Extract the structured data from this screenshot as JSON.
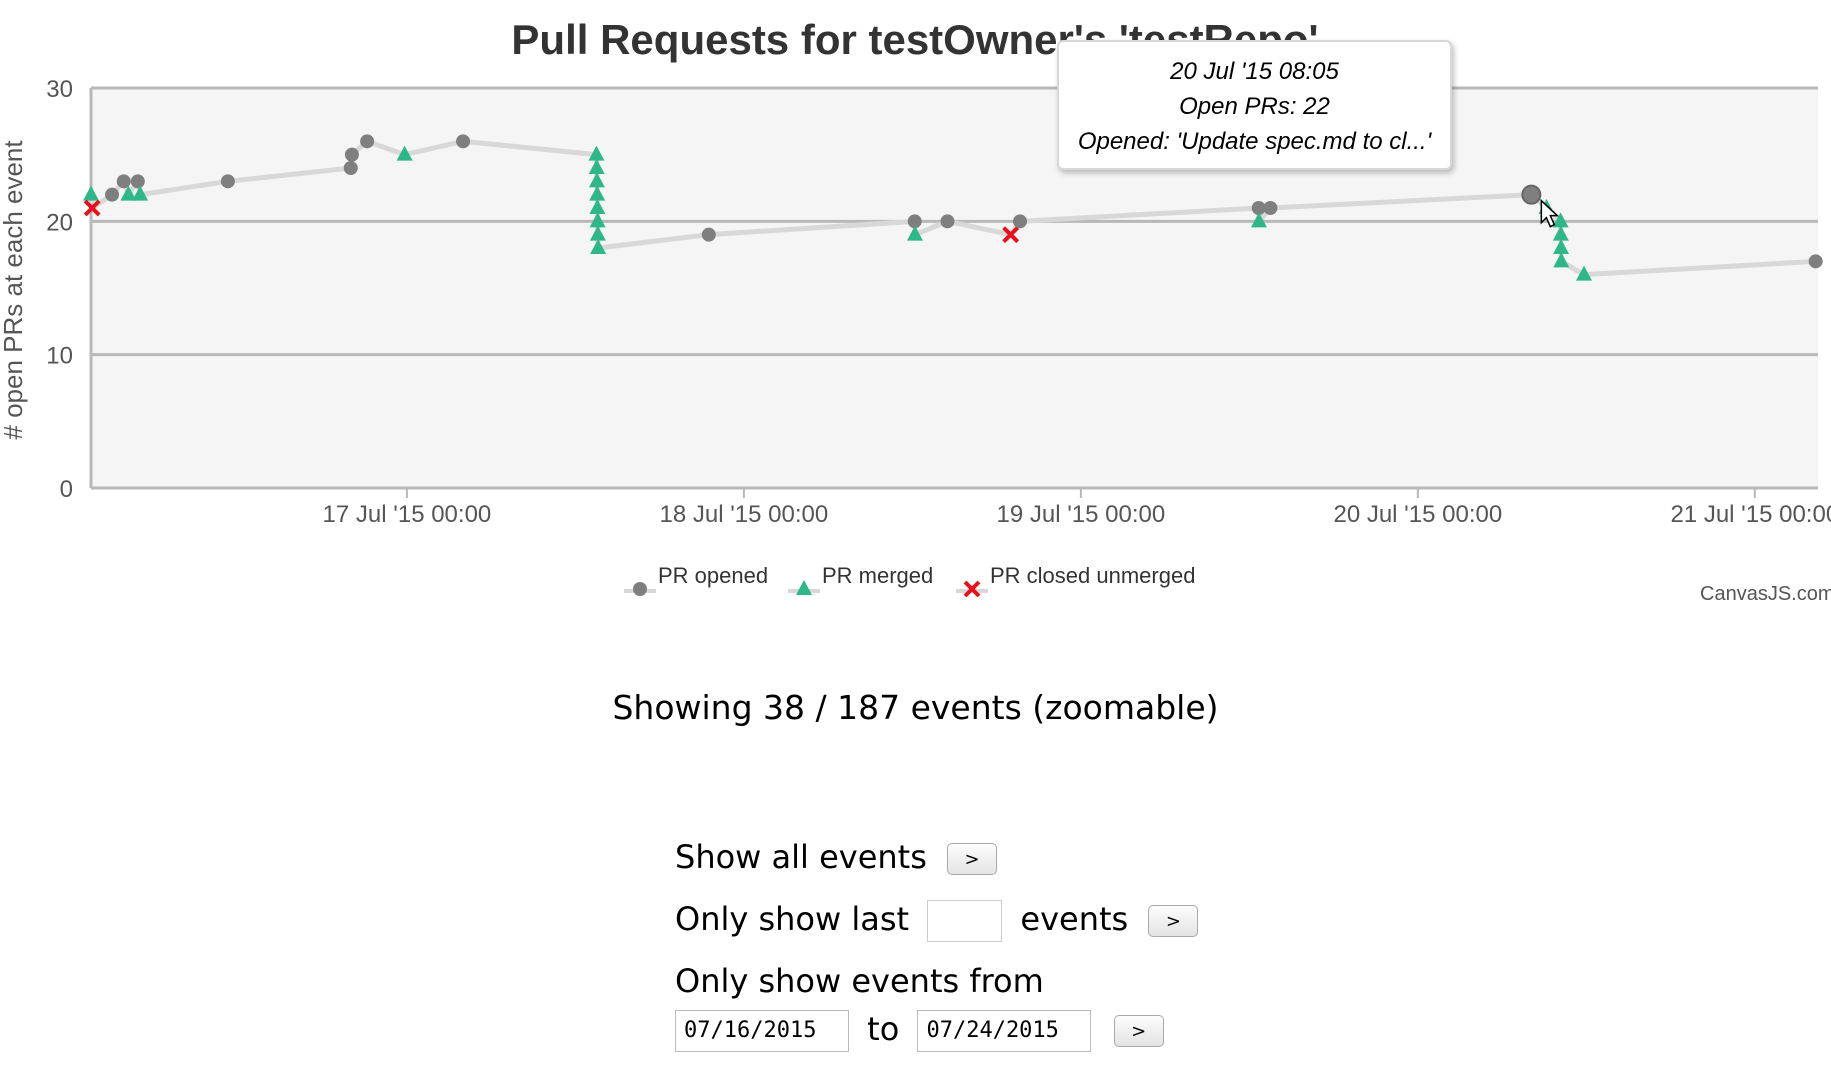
{
  "chart_data": {
    "type": "line",
    "title": "Pull Requests for testOwner's 'testRepo'",
    "xlabel": "",
    "ylabel": "# open PRs at each event",
    "ylim": [
      0,
      30
    ],
    "yticks": [
      0,
      10,
      20,
      30
    ],
    "xlim": [
      "16 Jul '15 01:30",
      "21 Jul '15 04:30"
    ],
    "xticks": [
      "17 Jul '15 00:00",
      "18 Jul '15 00:00",
      "19 Jul '15 00:00",
      "20 Jul '15 00:00",
      "21 Jul '15 00:00"
    ],
    "legend_position": "bottom",
    "grid": true,
    "colors": {
      "opened": "#7f7f7f",
      "merged": "#2eb88a",
      "closed": "#e8101a",
      "line": "#d8d8d8",
      "plot_bg": "#f5f5f5"
    },
    "series": [
      {
        "name": "PR opened",
        "marker": "circle"
      },
      {
        "name": "PR merged",
        "marker": "triangle"
      },
      {
        "name": "PR closed unmerged",
        "marker": "cross"
      }
    ],
    "points": [
      {
        "t": "16 Jul '15 01:30",
        "y": 22,
        "kind": "merged"
      },
      {
        "t": "16 Jul '15 01:35",
        "y": 21,
        "kind": "closed"
      },
      {
        "t": "16 Jul '15 03:00",
        "y": 22,
        "kind": "opened"
      },
      {
        "t": "16 Jul '15 03:50",
        "y": 23,
        "kind": "opened"
      },
      {
        "t": "16 Jul '15 04:10",
        "y": 22,
        "kind": "merged"
      },
      {
        "t": "16 Jul '15 04:50",
        "y": 23,
        "kind": "opened"
      },
      {
        "t": "16 Jul '15 05:00",
        "y": 22,
        "kind": "merged"
      },
      {
        "t": "16 Jul '15 11:15",
        "y": 23,
        "kind": "opened"
      },
      {
        "t": "16 Jul '15 20:00",
        "y": 24,
        "kind": "opened"
      },
      {
        "t": "16 Jul '15 20:05",
        "y": 25,
        "kind": "opened"
      },
      {
        "t": "16 Jul '15 21:10",
        "y": 26,
        "kind": "opened"
      },
      {
        "t": "16 Jul '15 23:50",
        "y": 25,
        "kind": "merged"
      },
      {
        "t": "17 Jul '15 04:00",
        "y": 26,
        "kind": "opened"
      },
      {
        "t": "17 Jul '15 13:30",
        "y": 25,
        "kind": "merged"
      },
      {
        "t": "17 Jul '15 13:31",
        "y": 24,
        "kind": "merged"
      },
      {
        "t": "17 Jul '15 13:32",
        "y": 23,
        "kind": "merged"
      },
      {
        "t": "17 Jul '15 13:33",
        "y": 22,
        "kind": "merged"
      },
      {
        "t": "17 Jul '15 13:34",
        "y": 21,
        "kind": "merged"
      },
      {
        "t": "17 Jul '15 13:35",
        "y": 20,
        "kind": "merged"
      },
      {
        "t": "17 Jul '15 13:36",
        "y": 19,
        "kind": "merged"
      },
      {
        "t": "17 Jul '15 13:37",
        "y": 18,
        "kind": "merged"
      },
      {
        "t": "17 Jul '15 21:30",
        "y": 19,
        "kind": "opened"
      },
      {
        "t": "18 Jul '15 12:10",
        "y": 20,
        "kind": "opened"
      },
      {
        "t": "18 Jul '15 12:11",
        "y": 19,
        "kind": "merged"
      },
      {
        "t": "18 Jul '15 14:30",
        "y": 20,
        "kind": "opened"
      },
      {
        "t": "18 Jul '15 19:00",
        "y": 19,
        "kind": "closed"
      },
      {
        "t": "18 Jul '15 19:40",
        "y": 20,
        "kind": "opened"
      },
      {
        "t": "19 Jul '15 12:40",
        "y": 21,
        "kind": "opened"
      },
      {
        "t": "19 Jul '15 12:41",
        "y": 20,
        "kind": "merged"
      },
      {
        "t": "19 Jul '15 13:30",
        "y": 21,
        "kind": "opened"
      },
      {
        "t": "20 Jul '15 08:05",
        "y": 22,
        "kind": "opened"
      },
      {
        "t": "20 Jul '15 09:10",
        "y": 21,
        "kind": "merged"
      },
      {
        "t": "20 Jul '15 10:10",
        "y": 20,
        "kind": "merged"
      },
      {
        "t": "20 Jul '15 10:11",
        "y": 19,
        "kind": "merged"
      },
      {
        "t": "20 Jul '15 10:12",
        "y": 18,
        "kind": "merged"
      },
      {
        "t": "20 Jul '15 10:13",
        "y": 17,
        "kind": "merged"
      },
      {
        "t": "20 Jul '15 11:50",
        "y": 16,
        "kind": "merged"
      },
      {
        "t": "21 Jul '15 04:20",
        "y": 17,
        "kind": "opened"
      }
    ]
  },
  "tooltip": {
    "date": "20 Jul '15 08:05",
    "open_prs": "Open PRs: 22",
    "opened": "Opened: 'Update spec.md to cl...'"
  },
  "watermark": "CanvasJS.com",
  "summary": "Showing 38 / 187 events (zoomable)",
  "controls": {
    "show_all_label": "Show all events",
    "only_last_label": "Only show last",
    "only_last_value": "",
    "events_suffix": "events",
    "from_label": "Only show events from",
    "from_date": "07/16/2015",
    "to_label": "to",
    "to_date": "07/24/2015",
    "go_button": ">"
  }
}
